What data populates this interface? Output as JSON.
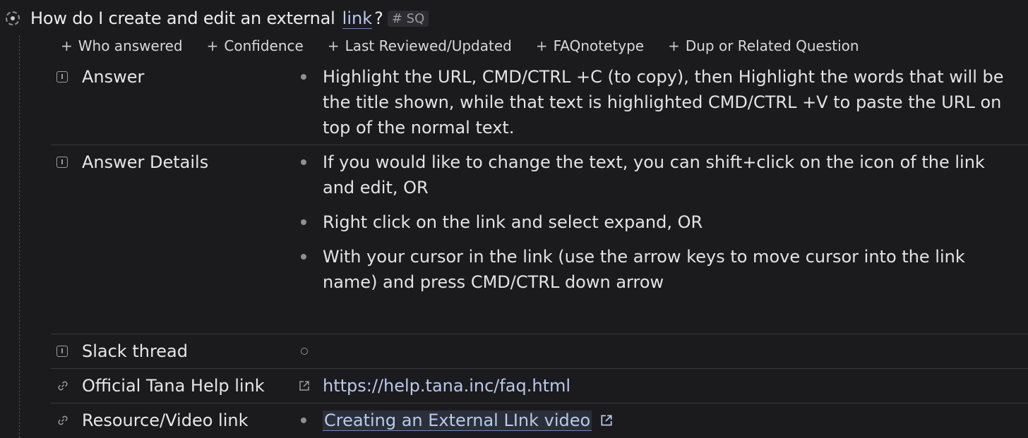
{
  "node": {
    "title": "How do I create and edit an external",
    "title_link": "link",
    "title_suffix": "?",
    "tag": "# SQ"
  },
  "add_fields": [
    {
      "label": "Who answered"
    },
    {
      "label": "Confidence"
    },
    {
      "label": "Last Reviewed/Updated"
    },
    {
      "label": "FAQnotetype"
    },
    {
      "label": "Dup or Related Question"
    }
  ],
  "fields": {
    "answer": {
      "label": "Answer",
      "values": [
        "Highlight the URL, CMD/CTRL +C (to copy), then Highlight the words that will be the title shown, while that text is highlighted CMD/CTRL +V to paste the URL on top of the normal text."
      ]
    },
    "answer_details": {
      "label": "Answer Details",
      "values": [
        "If you would like to change the text, you can shift+click on the  icon of the link and edit, OR",
        "Right click on the link and select expand, OR",
        "With your cursor in the link (use the arrow keys to move cursor into the link name) and press CMD/CTRL down arrow"
      ]
    },
    "slack_thread": {
      "label": "Slack thread"
    },
    "official_help": {
      "label": "Official Tana Help link",
      "url": "https://help.tana.inc/faq.html"
    },
    "resource_video": {
      "label": "Resource/Video link",
      "link_text": "Creating an External LInk video"
    }
  },
  "icons": {
    "node_bullet": "dashed-ring-bullet-icon",
    "text_field": "text-field-icon",
    "url_field": "chain-link-icon",
    "external": "external-link-icon"
  }
}
